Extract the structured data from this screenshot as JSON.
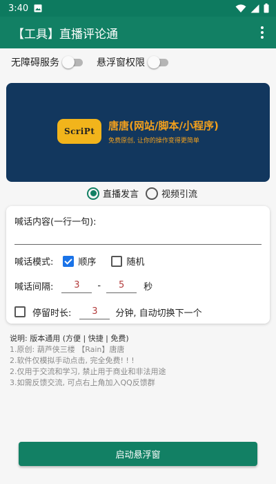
{
  "status_bar": {
    "time": "3:40",
    "icons": [
      "image-icon",
      "wifi-icon",
      "signal-icon",
      "battery-icon"
    ]
  },
  "app_bar": {
    "title": "【工具】直播评论通",
    "menu_icon": "more-vert-icon"
  },
  "toggles": [
    {
      "label": "无障碍服务",
      "on": false
    },
    {
      "label": "悬浮窗权限",
      "on": false
    }
  ],
  "banner": {
    "logo_text": "ScriPt",
    "title": "唐唐(网站/脚本/小程序)",
    "subtitle": "免费原创, 让你的操作变得更简单"
  },
  "mode_radios": {
    "selected": "直播发言",
    "options": [
      "直播发言",
      "视频引流"
    ]
  },
  "form": {
    "shout_label": "喊话内容(一行一句):",
    "shout_value": "",
    "mode_label": "喊话模式:",
    "mode_options": [
      {
        "label": "顺序",
        "checked": true
      },
      {
        "label": "随机",
        "checked": false
      }
    ],
    "interval_label": "喊话间隔:",
    "interval_min": "3",
    "interval_sep": "-",
    "interval_max": "5",
    "interval_unit": "秒",
    "stay_checked": false,
    "stay_label": "停留时长:",
    "stay_value": "3",
    "stay_suffix": "分钟, 自动切换下一个"
  },
  "notes": [
    "说明: 版本通用 (方便 | 快捷 | 免费)",
    "1.原创: 葫芦侠三楼 【Rain】唐唐",
    "2.软件仅模拟手动点击, 完全免费! ! !",
    "2.仅用于交流和学习, 禁止用于商业和非法用途",
    "3.如需反馈交流, 可点右上角加入QQ反馈群"
  ],
  "colors": {
    "primary": "#128064",
    "status_bar": "#0d7a5f",
    "banner_bg": "#12375e",
    "banner_text": "#f3a01c",
    "checkbox": "#1a73e8",
    "number_text": "#b23b3b"
  },
  "start_button": "启动悬浮窗"
}
